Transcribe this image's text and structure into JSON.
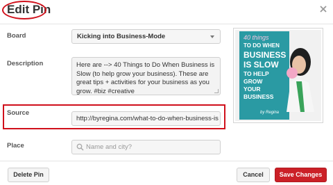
{
  "header": {
    "title": "Edit Pin",
    "close_icon": "close-icon"
  },
  "form": {
    "board": {
      "label": "Board",
      "value": "Kicking into Business-Mode"
    },
    "description": {
      "label": "Description",
      "value": "Here are --> 40 Things to Do When Business is Slow (to help grow your business). These are great tips + activities for your business as you grow. #biz #creative"
    },
    "source": {
      "label": "Source",
      "value": "http://byregina.com/what-to-do-when-business-is"
    },
    "place": {
      "label": "Place",
      "placeholder": "Name and city?"
    }
  },
  "thumbnail": {
    "line1": "40 things",
    "line2": "TO DO WHEN",
    "line3": "BUSINESS",
    "line4": "IS SLOW",
    "line5": "TO HELP",
    "line6": "GROW",
    "line7": "YOUR",
    "line8": "BUSINESS",
    "credit": "by Regina"
  },
  "footer": {
    "delete_label": "Delete Pin",
    "cancel_label": "Cancel",
    "save_label": "Save Changes"
  },
  "colors": {
    "accent_red": "#cb2027",
    "highlight_red": "#d0101b",
    "thumbnail_teal": "#2a9aa3"
  }
}
